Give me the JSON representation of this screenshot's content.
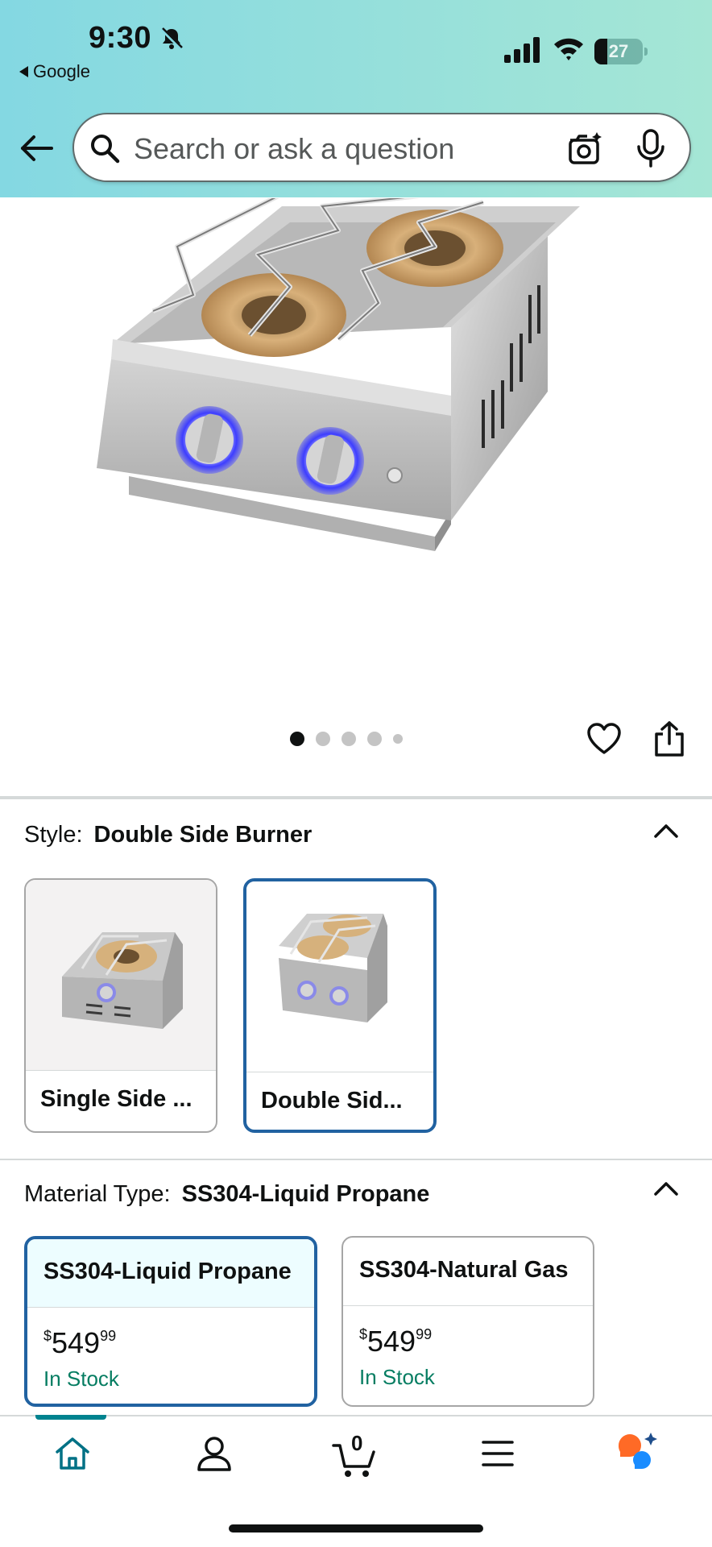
{
  "status_bar": {
    "time": "9:30",
    "back_app": "Google",
    "battery_level": "27"
  },
  "search": {
    "placeholder": "Search or ask a question"
  },
  "gallery": {
    "image_count": 5,
    "active_index": 0
  },
  "style": {
    "label": "Style:",
    "value": "Double Side Burner",
    "options": [
      {
        "caption": "Single Side ...",
        "selected": false
      },
      {
        "caption": "Double Sid...",
        "selected": true
      }
    ]
  },
  "material": {
    "label": "Material Type:",
    "value": "SS304-Liquid Propane",
    "options": [
      {
        "name": "SS304-Liquid Propane",
        "price_symbol": "$",
        "price_whole": "549",
        "price_fraction": "99",
        "stock": "In Stock",
        "selected": true
      },
      {
        "name": "SS304-Natural Gas",
        "price_symbol": "$",
        "price_whole": "549",
        "price_fraction": "99",
        "stock": "In Stock",
        "selected": false
      }
    ]
  },
  "bottom_nav": {
    "items": [
      "home-icon",
      "account-icon",
      "cart-icon",
      "menu-icon",
      "rufus-icon"
    ],
    "cart_count": "0"
  },
  "colors": {
    "accent": "#2162a1",
    "in_stock": "#067d62",
    "nav_active": "#00838f"
  }
}
